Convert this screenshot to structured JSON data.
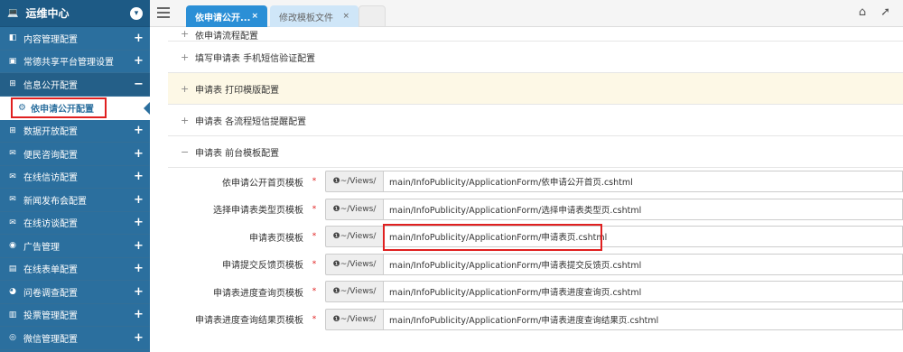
{
  "sidebar": {
    "title": "运维中心",
    "items": [
      {
        "label": "内容管理配置",
        "icon": "◧",
        "toggle": "+"
      },
      {
        "label": "常德共享平台管理设置",
        "icon": "▣",
        "toggle": "+"
      },
      {
        "label": "信息公开配置",
        "icon": "⊞",
        "toggle": "−"
      },
      {
        "label": "数据开放配置",
        "icon": "⊞",
        "toggle": "+"
      },
      {
        "label": "便民咨询配置",
        "icon": "✉",
        "toggle": "+"
      },
      {
        "label": "在线信访配置",
        "icon": "✉",
        "toggle": "+"
      },
      {
        "label": "新闻发布会配置",
        "icon": "✉",
        "toggle": "+"
      },
      {
        "label": "在线访谈配置",
        "icon": "✉",
        "toggle": "+"
      },
      {
        "label": "广告管理",
        "icon": "◉",
        "toggle": "+"
      },
      {
        "label": "在线表单配置",
        "icon": "▤",
        "toggle": "+"
      },
      {
        "label": "问卷调查配置",
        "icon": "◕",
        "toggle": "+"
      },
      {
        "label": "投票管理配置",
        "icon": "▥",
        "toggle": "+"
      },
      {
        "label": "微信管理配置",
        "icon": "◎",
        "toggle": "+"
      }
    ],
    "active_sub": "依申请公开配置"
  },
  "tabs": {
    "active": "依申请公开...",
    "second": "修改模板文件",
    "close": "×"
  },
  "accordion": [
    {
      "label": "依申请流程配置",
      "toggle": "+"
    },
    {
      "label": "填写申请表 手机短信验证配置",
      "toggle": "+"
    },
    {
      "label": "申请表 打印模版配置",
      "toggle": "+"
    },
    {
      "label": "申请表 各流程短信提醒配置",
      "toggle": "+"
    },
    {
      "label": "申请表 前台模板配置",
      "toggle": "−"
    }
  ],
  "form": {
    "addon": "❶~/Views/",
    "required_mark": "*",
    "rows": [
      {
        "label": "依申请公开首页模板",
        "value": "main/InfoPublicity/ApplicationForm/依申请公开首页.cshtml"
      },
      {
        "label": "选择申请表类型页模板",
        "value": "main/InfoPublicity/ApplicationForm/选择申请表类型页.cshtml"
      },
      {
        "label": "申请表页模板",
        "value": "main/InfoPublicity/ApplicationForm/申请表页.cshtml"
      },
      {
        "label": "申请提交反馈页模板",
        "value": "main/InfoPublicity/ApplicationForm/申请表提交反馈页.cshtml"
      },
      {
        "label": "申请表进度查询页模板",
        "value": "main/InfoPublicity/ApplicationForm/申请表进度查询页.cshtml"
      },
      {
        "label": "申请表进度查询结果页模板",
        "value": "main/InfoPublicity/ApplicationForm/申请表进度查询结果页.cshtml"
      }
    ]
  },
  "colors": {
    "sidebar": "#2b6f9e",
    "tab_active": "#2b8fd6",
    "highlight": "#e02020"
  }
}
